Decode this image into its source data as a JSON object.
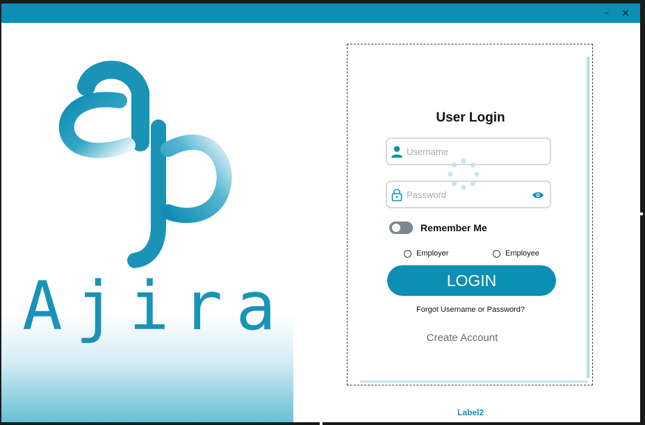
{
  "window": {
    "minimize_glyph": "–",
    "close_glyph": "✕"
  },
  "brand": {
    "wordmark": "Ajira",
    "logo_icon": "ajira-ap-monogram-icon",
    "accent_color": "#0b8fb5"
  },
  "login": {
    "title": "User Login",
    "username_placeholder": "Username",
    "password_placeholder": "Password",
    "remember_label": "Remember Me",
    "roles": [
      {
        "label": "Employer"
      },
      {
        "label": "Employee"
      }
    ],
    "login_label": "LOGIN",
    "forgot_label": "Forgot Username or Password?",
    "create_label": "Create Account",
    "user_icon": "user-icon",
    "lock_icon": "lock-icon",
    "eye_icon": "eye-icon",
    "spinner_icon": "loading-spinner-icon"
  },
  "footer": {
    "label": "Label2"
  }
}
